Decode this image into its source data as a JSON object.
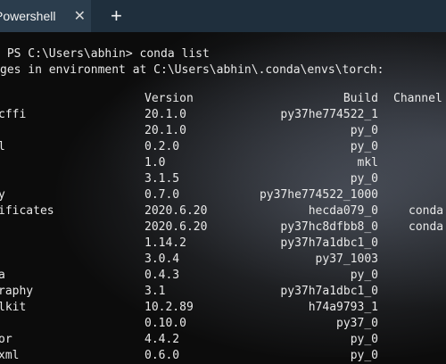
{
  "window": {
    "tab_title": "Powershell",
    "close_glyph": "✕",
    "new_tab_glyph": "+"
  },
  "terminal": {
    "prompt": " PS C:\\Users\\abhin> conda list",
    "env_line": "ges in environment at C:\\Users\\abhin\\.conda\\envs\\torch:",
    "headers": {
      "version": "Version",
      "build": "Build",
      "channel": "Channel"
    },
    "rows": [
      {
        "name": "cffi",
        "version": "20.1.0",
        "build": "py37he774522_1",
        "channel": ""
      },
      {
        "name": "",
        "version": "20.1.0",
        "build": "py_0",
        "channel": ""
      },
      {
        "name": "l",
        "version": "0.2.0",
        "build": "py_0",
        "channel": ""
      },
      {
        "name": "",
        "version": "1.0",
        "build": "mkl",
        "channel": ""
      },
      {
        "name": "",
        "version": "3.1.5",
        "build": "py_0",
        "channel": ""
      },
      {
        "name": "y",
        "version": "0.7.0",
        "build": "py37he774522_1000",
        "channel": ""
      },
      {
        "name": "ificates",
        "version": "2020.6.20",
        "build": "hecda079_0",
        "channel": "conda"
      },
      {
        "name": "",
        "version": "2020.6.20",
        "build": "py37hc8dfbb8_0",
        "channel": "conda"
      },
      {
        "name": "",
        "version": "1.14.2",
        "build": "py37h7a1dbc1_0",
        "channel": ""
      },
      {
        "name": "",
        "version": "3.0.4",
        "build": "py37_1003",
        "channel": ""
      },
      {
        "name": "a",
        "version": "0.4.3",
        "build": "py_0",
        "channel": ""
      },
      {
        "name": "raphy",
        "version": "3.1",
        "build": "py37h7a1dbc1_0",
        "channel": ""
      },
      {
        "name": "lkit",
        "version": "10.2.89",
        "build": "h74a9793_1",
        "channel": ""
      },
      {
        "name": "",
        "version": "0.10.0",
        "build": "py37_0",
        "channel": ""
      },
      {
        "name": "or",
        "version": "4.4.2",
        "build": "py_0",
        "channel": ""
      },
      {
        "name": "xml",
        "version": "0.6.0",
        "build": "py_0",
        "channel": ""
      }
    ]
  }
}
